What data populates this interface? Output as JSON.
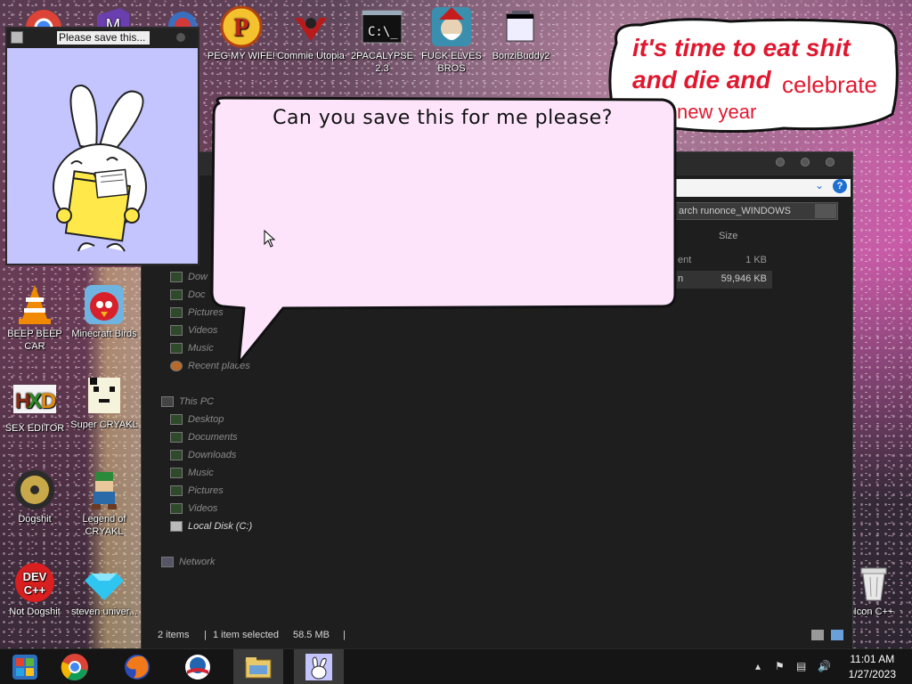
{
  "desktop": {
    "icons": [
      {
        "id": "peg",
        "label": "PEG MY WIFE!"
      },
      {
        "id": "commie",
        "label": "Commie Utopia"
      },
      {
        "id": "2pac",
        "label": "2PACALYPSE 2.3"
      },
      {
        "id": "elves",
        "label": "FUCK ELVES BROS"
      },
      {
        "id": "bonzi",
        "label": "BonziBuddy2"
      },
      {
        "id": "vlc",
        "label": "BEEP BEEP CAR"
      },
      {
        "id": "angry",
        "label": "Minecraft Birds"
      },
      {
        "id": "hxd",
        "label": "SEX EDITOR"
      },
      {
        "id": "cryakl",
        "label": "Super CRYAKL"
      },
      {
        "id": "dogshit",
        "label": "Dogshit"
      },
      {
        "id": "legend",
        "label": "Legend of CRYAKL"
      },
      {
        "id": "devcpp",
        "label": "Not Dogshit"
      },
      {
        "id": "steven",
        "label": "steven univer..."
      },
      {
        "id": "recycle",
        "label": "Icon C++"
      }
    ]
  },
  "cloud": {
    "line1": "it's time to eat shit",
    "line2a": "and die and",
    "line2b": "celebrate",
    "line3": "new year"
  },
  "bunny_window": {
    "title": "Please save this..."
  },
  "bubble": {
    "message": "Can you save this for me please?"
  },
  "explorer": {
    "search_placeholder": "Search runonce_WINDOWS",
    "search_visible": "arch runonce_WINDOWS",
    "column_size": "Size",
    "files": [
      {
        "name": "ent",
        "size": "1 KB",
        "selected": false
      },
      {
        "name": "n",
        "size": "59,946 KB",
        "selected": true
      }
    ],
    "quick_access": [
      "Dow",
      "Doc",
      "Pictures",
      "Videos",
      "Music",
      "Recent places"
    ],
    "this_pc_label": "This PC",
    "this_pc_items": [
      "Desktop",
      "Documents",
      "Downloads",
      "Music",
      "Pictures",
      "Videos"
    ],
    "local_disk": "Local Disk (C:)",
    "network": "Network",
    "status": {
      "items": "2 items",
      "selected": "1 item selected",
      "size": "58.5 MB"
    }
  },
  "taskbar": {
    "time": "11:01 AM",
    "date": "1/27/2023"
  },
  "colors": {
    "cloud_text": "#e0182f",
    "bubble_fill": "#fde4fb",
    "bunny_bg": "#c4c4ff"
  }
}
